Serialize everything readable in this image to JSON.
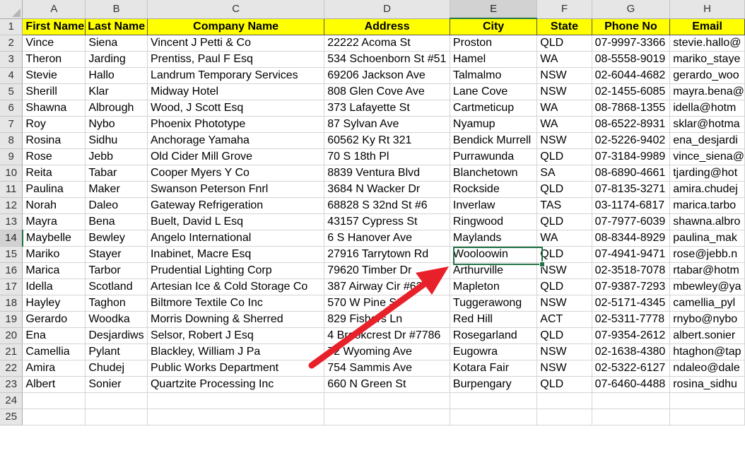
{
  "columns": [
    "A",
    "B",
    "C",
    "D",
    "E",
    "F",
    "G",
    "H"
  ],
  "selected_column": "E",
  "selected_row": 14,
  "row_numbers": [
    1,
    2,
    3,
    4,
    5,
    6,
    7,
    8,
    9,
    10,
    11,
    12,
    13,
    14,
    15,
    16,
    17,
    18,
    19,
    20,
    21,
    22,
    23,
    24,
    25
  ],
  "header": [
    "First Name",
    "Last Name",
    "Company Name",
    "Address",
    "City",
    "State",
    "Phone No",
    "Email"
  ],
  "rows": [
    [
      "Vince",
      "Siena",
      "Vincent J Petti & Co",
      "22222 Acoma St",
      "Proston",
      "QLD",
      "07-9997-3366",
      "stevie.hallo@"
    ],
    [
      "Theron",
      "Jarding",
      "Prentiss, Paul F Esq",
      "534 Schoenborn St #51",
      "Hamel",
      "WA",
      "08-5558-9019",
      "mariko_staye"
    ],
    [
      "Stevie",
      "Hallo",
      "Landrum Temporary Services",
      "69206 Jackson Ave",
      "Talmalmo",
      "NSW",
      "02-6044-4682",
      "gerardo_woo"
    ],
    [
      "Sherill",
      "Klar",
      "Midway Hotel",
      "808 Glen Cove Ave",
      "Lane Cove",
      "NSW",
      "02-1455-6085",
      "mayra.bena@"
    ],
    [
      "Shawna",
      "Albrough",
      "Wood, J Scott Esq",
      "373 Lafayette St",
      "Cartmeticup",
      "WA",
      "08-7868-1355",
      "idella@hotm"
    ],
    [
      "Roy",
      "Nybo",
      "Phoenix Phototype",
      "87 Sylvan Ave",
      "Nyamup",
      "WA",
      "08-6522-8931",
      "sklar@hotma"
    ],
    [
      "Rosina",
      "Sidhu",
      "Anchorage Yamaha",
      "60562 Ky Rt 321",
      "Bendick Murrell",
      "NSW",
      "02-5226-9402",
      "ena_desjardi"
    ],
    [
      "Rose",
      "Jebb",
      "Old Cider Mill Grove",
      "70 S 18th Pl",
      "Purrawunda",
      "QLD",
      "07-3184-9989",
      "vince_siena@"
    ],
    [
      "Reita",
      "Tabar",
      "Cooper Myers Y Co",
      "8839 Ventura Blvd",
      "Blanchetown",
      "SA",
      "08-6890-4661",
      "tjarding@hot"
    ],
    [
      "Paulina",
      "Maker",
      "Swanson Peterson Fnrl",
      "3684 N Wacker Dr",
      "Rockside",
      "QLD",
      "07-8135-3271",
      "amira.chudej"
    ],
    [
      "Norah",
      "Daleo",
      "Gateway Refrigeration",
      "68828 S 32nd St #6",
      "Inverlaw",
      "TAS",
      "03-1174-6817",
      "marica.tarbo"
    ],
    [
      "Mayra",
      "Bena",
      "Buelt, David L Esq",
      "43157 Cypress St",
      "Ringwood",
      "QLD",
      "07-7977-6039",
      "shawna.albro"
    ],
    [
      "Maybelle",
      "Bewley",
      "Angelo International",
      "6 S Hanover Ave",
      "Maylands",
      "WA",
      "08-8344-8929",
      "paulina_mak"
    ],
    [
      "Mariko",
      "Stayer",
      "Inabinet, Macre Esq",
      "27916 Tarrytown Rd",
      "Wooloowin",
      "QLD",
      "07-4941-9471",
      "rose@jebb.n"
    ],
    [
      "Marica",
      "Tarbor",
      "Prudential Lighting Corp",
      "79620 Timber Dr",
      "Arthurville",
      "NSW",
      "02-3518-7078",
      "rtabar@hotm"
    ],
    [
      "Idella",
      "Scotland",
      "Artesian Ice & Cold Storage Co",
      "387 Airway Cir #62",
      "Mapleton",
      "QLD",
      "07-9387-7293",
      "mbewley@ya"
    ],
    [
      "Hayley",
      "Taghon",
      "Biltmore Textile Co Inc",
      "570 W Pine St",
      "Tuggerawong",
      "NSW",
      "02-5171-4345",
      "camellia_pyl"
    ],
    [
      "Gerardo",
      "Woodka",
      "Morris Downing & Sherred",
      "829 Fishers Ln",
      "Red Hill",
      "ACT",
      "02-5311-7778",
      "rnybo@nybo"
    ],
    [
      "Ena",
      "Desjardiws",
      "Selsor, Robert J Esq",
      "4 Brookcrest Dr #7786",
      "Rosegarland",
      "QLD",
      "07-9354-2612",
      "albert.sonier"
    ],
    [
      "Camellia",
      "Pylant",
      "Blackley, William J Pa",
      "72 Wyoming Ave",
      "Eugowra",
      "NSW",
      "02-1638-4380",
      "htaghon@tap"
    ],
    [
      "Amira",
      "Chudej",
      "Public Works Department",
      "754 Sammis Ave",
      "Kotara Fair",
      "NSW",
      "02-5322-6127",
      "ndaleo@dale"
    ],
    [
      "Albert",
      "Sonier",
      "Quartzite Processing Inc",
      "660 N Green St",
      "Burpengary",
      "QLD",
      "07-6460-4488",
      "rosina_sidhu"
    ]
  ],
  "colors": {
    "header_fill": "#ffff00",
    "selection": "#217346",
    "arrow": "#e8202a"
  }
}
